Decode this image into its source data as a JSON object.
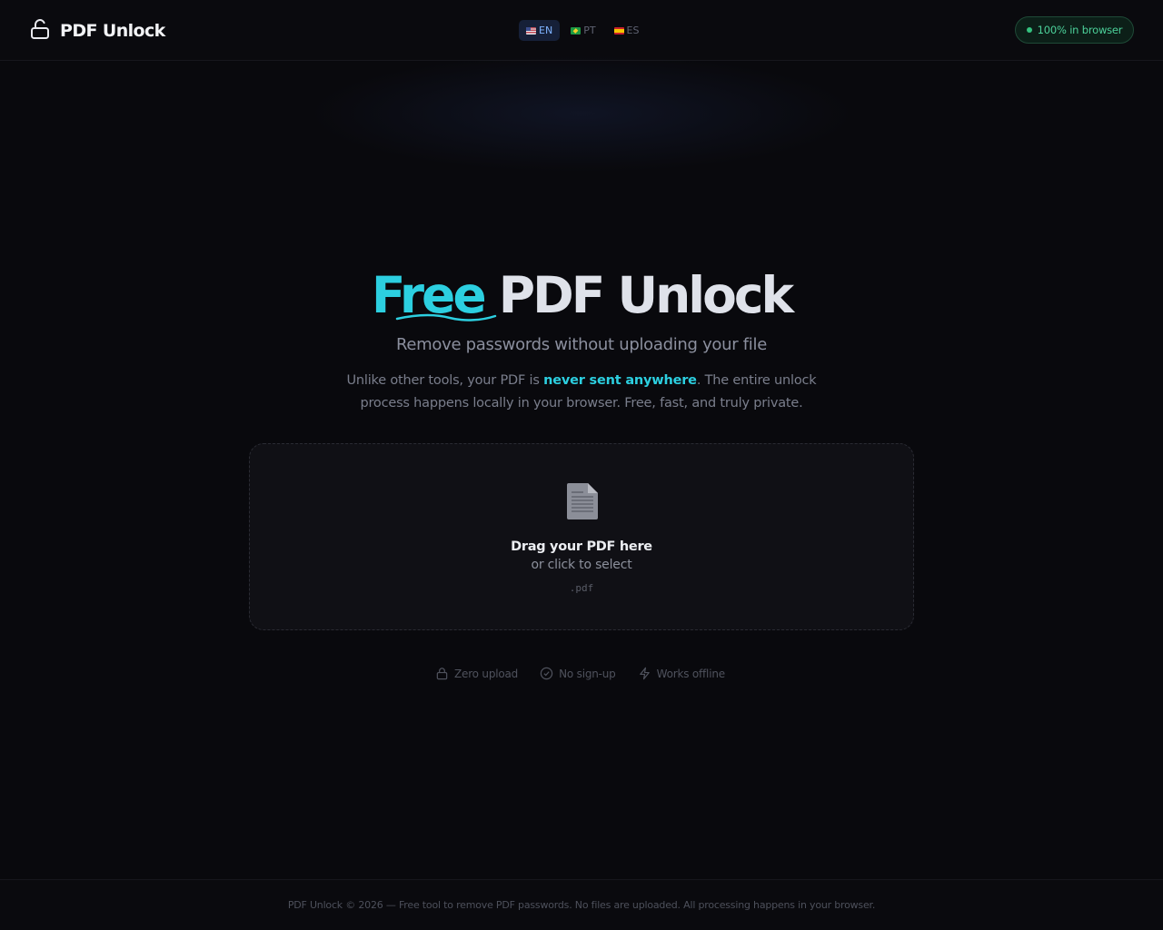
{
  "header": {
    "brand_name": "PDF Unlock",
    "languages": [
      {
        "code": "EN",
        "flag": "us",
        "active": true
      },
      {
        "code": "PT",
        "flag": "br",
        "active": false
      },
      {
        "code": "ES",
        "flag": "es",
        "active": false
      }
    ],
    "badge_label": "100% in browser"
  },
  "hero": {
    "title_highlight": "Free",
    "title_rest": "PDF Unlock",
    "subtitle": "Remove passwords without uploading your file",
    "desc_before": "Unlike other tools, your PDF is ",
    "desc_highlight": "never sent anywhere",
    "desc_after": ". The entire unlock process happens locally in your browser. Free, fast, and truly private."
  },
  "dropzone": {
    "title": "Drag your PDF here",
    "subtitle": "or click to select",
    "accepted_ext": ".pdf",
    "icon": "document-icon"
  },
  "features": [
    {
      "label": "Zero upload",
      "icon": "lock-icon"
    },
    {
      "label": "No sign-up",
      "icon": "check-circle-icon"
    },
    {
      "label": "Works offline",
      "icon": "lightning-icon"
    }
  ],
  "footer": {
    "text": "PDF Unlock © 2026 — Free tool to remove PDF passwords. No files are uploaded. All processing happens in your browser."
  },
  "colors": {
    "background": "#09090d",
    "accent_cyan": "#2ccfe0",
    "badge_green": "#4cd19a",
    "active_lang": "#7fb3ff"
  }
}
